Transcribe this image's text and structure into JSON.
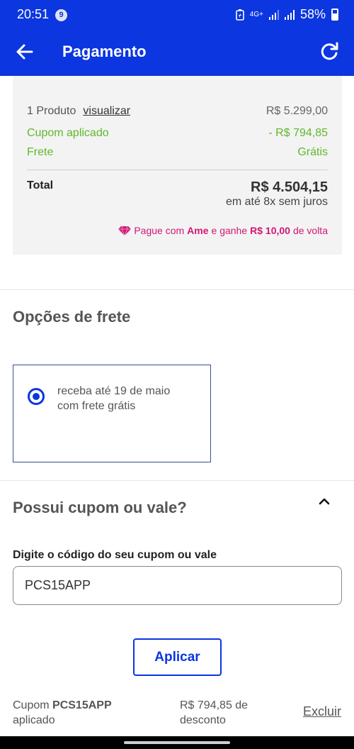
{
  "status_bar": {
    "time": "20:51",
    "notification_count": "9",
    "network": "4G+",
    "battery": "58%"
  },
  "app_bar": {
    "title": "Pagamento"
  },
  "summary": {
    "products_label": "1 Produto",
    "view_link": "visualizar",
    "products_value": "R$ 5.299,00",
    "coupon_label": "Cupom aplicado",
    "coupon_value": "- R$ 794,85",
    "shipping_label": "Frete",
    "shipping_value": "Grátis",
    "total_label": "Total",
    "total_value": "R$ 4.504,15",
    "installments": "em até 8x sem juros",
    "ame": {
      "prefix": "Pague com",
      "brand": "Ame",
      "middle": "e ganhe",
      "amount": "R$ 10,00",
      "suffix": "de volta"
    }
  },
  "shipping_options": {
    "title": "Opções de frete",
    "option_line1": "receba até 19 de maio",
    "option_line2": "com frete grátis"
  },
  "coupon": {
    "title": "Possui cupom ou vale?",
    "field_label": "Digite o código do seu cupom ou vale",
    "field_value": "PCS15APP",
    "apply_label": "Aplicar",
    "applied_prefix": "Cupom",
    "applied_code": "PCS15APP",
    "applied_suffix": "aplicado",
    "discount_line1": "R$ 794,85 de",
    "discount_line2": "desconto",
    "remove_label": "Excluir"
  },
  "colors": {
    "brand_blue": "#0b36e0",
    "success_green": "#5fb82c",
    "ame_pink": "#d21875"
  }
}
